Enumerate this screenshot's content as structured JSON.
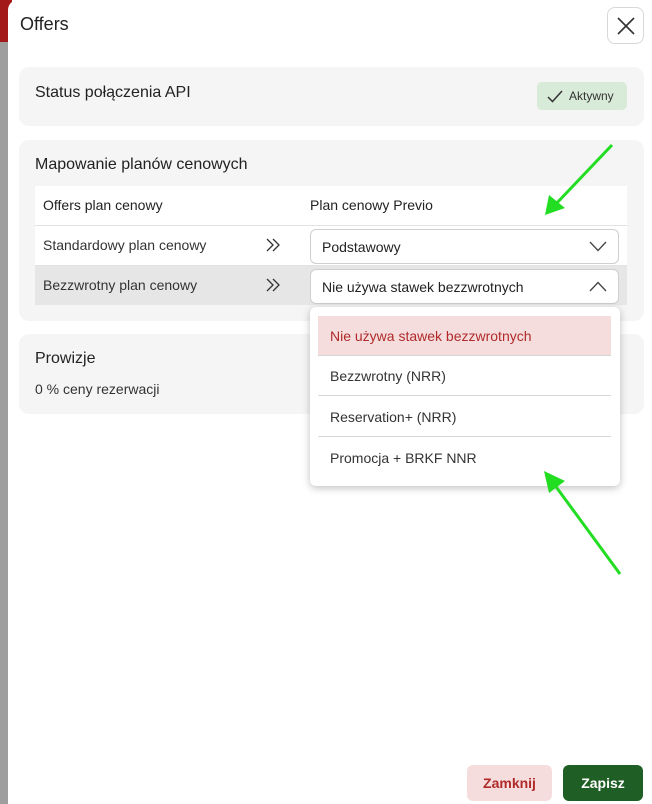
{
  "modal": {
    "title": "Offers",
    "close_icon": "close-icon"
  },
  "status_card": {
    "heading": "Status połączenia API",
    "badge_label": "Aktywny",
    "badge_icon": "check-icon"
  },
  "mapping_card": {
    "heading": "Mapowanie planów cenowych",
    "columns": [
      "Offers plan cenowy",
      "Plan cenowy Previo"
    ],
    "rows": [
      {
        "offers_plan": "Standardowy plan cenowy",
        "previo_plan": "Podstawowy",
        "expanded": false
      },
      {
        "offers_plan": "Bezzwrotny plan cenowy",
        "previo_plan": "Nie używa stawek bezzwrotnych",
        "expanded": true
      }
    ]
  },
  "dropdown": {
    "options": [
      "Nie używa stawek bezzwrotnych",
      "Bezzwrotny (NRR)",
      "Reservation+ (NRR)",
      "Promocja + BRKF NNR"
    ],
    "selected_index": 0
  },
  "commission_card": {
    "heading": "Prowizje",
    "value": "0 % ceny rezerwacji"
  },
  "footer": {
    "cancel_label": "Zamknij",
    "save_label": "Zapisz"
  },
  "colors": {
    "accent_green": "#1f5e24",
    "badge_bg": "#d8ead8",
    "danger_text": "#b02a2a",
    "danger_bg": "#f6dddd",
    "annotation_arrow": "#22dd22"
  }
}
